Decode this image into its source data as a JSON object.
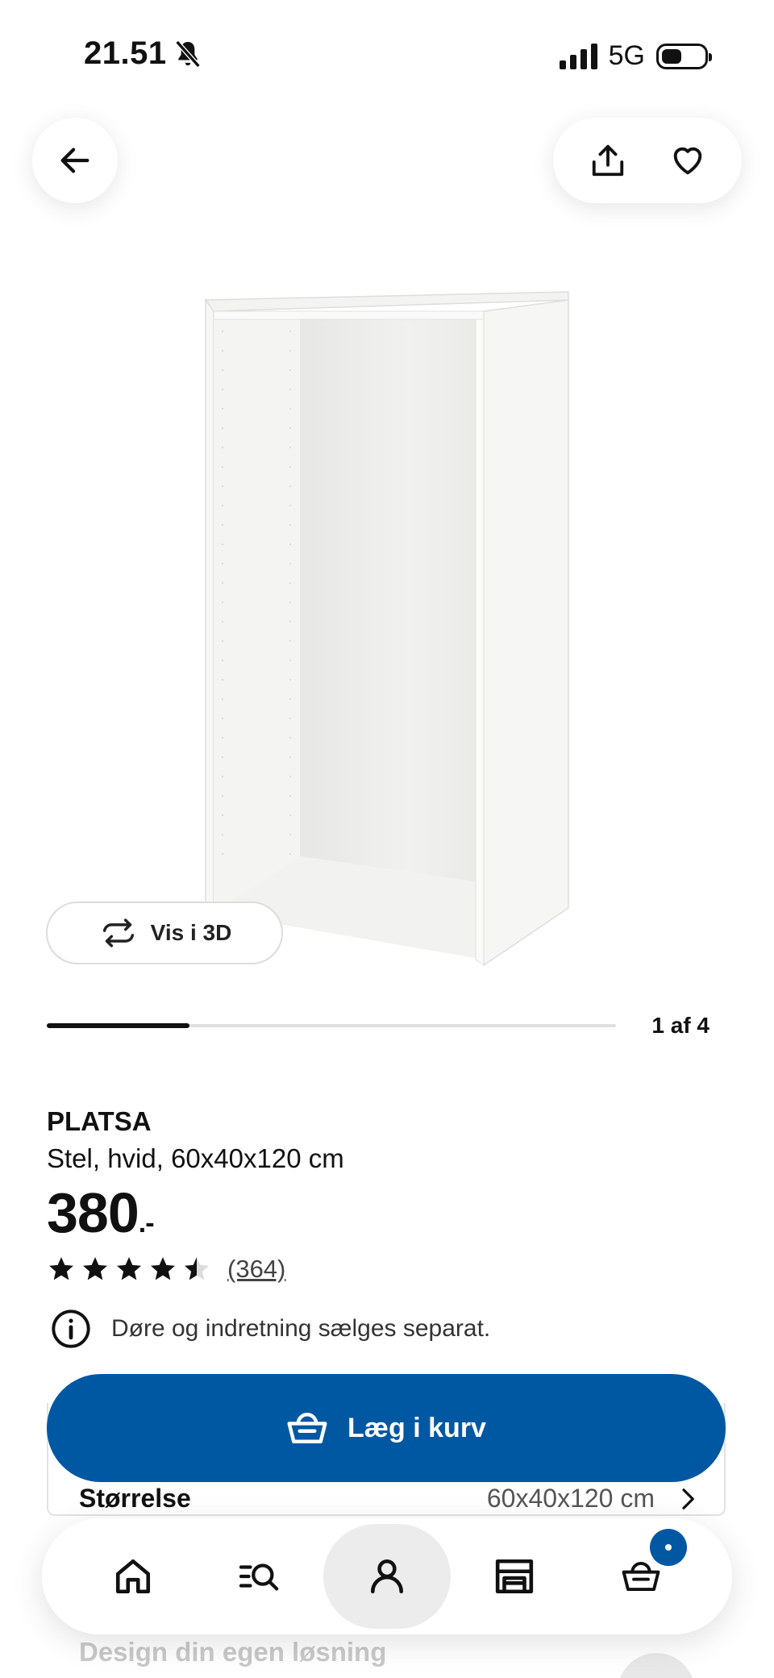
{
  "status_bar": {
    "time": "21.51",
    "network": "5G",
    "icons": [
      "bell-slash-icon",
      "signal-icon",
      "battery-icon"
    ]
  },
  "header": {
    "icons": [
      "arrow-left-icon",
      "share-icon",
      "heart-icon"
    ]
  },
  "gallery": {
    "view_3d_label": "Vis i 3D",
    "position_label": "1 af 4",
    "progress": 0.25
  },
  "product": {
    "name": "PLATSA",
    "description": "Stel, hvid, 60x40x120 cm",
    "price": "380",
    "price_suffix": ".-",
    "rating": 4.5,
    "rating_max": 5,
    "review_count": "(364)",
    "notice": "Døre og indretning sælges separat."
  },
  "cart": {
    "add_label": "Læg i kurv"
  },
  "size": {
    "label": "Størrelse",
    "value": "60x40x120 cm"
  },
  "design_link": "Design din egen løsning",
  "bottom_nav": {
    "items": [
      "home-icon",
      "search-list-icon",
      "profile-icon",
      "store-icon",
      "basket-icon"
    ],
    "active": "profile-icon"
  },
  "colors": {
    "primary_blue": "#0058a3",
    "text": "#111111",
    "muted": "#555555"
  }
}
